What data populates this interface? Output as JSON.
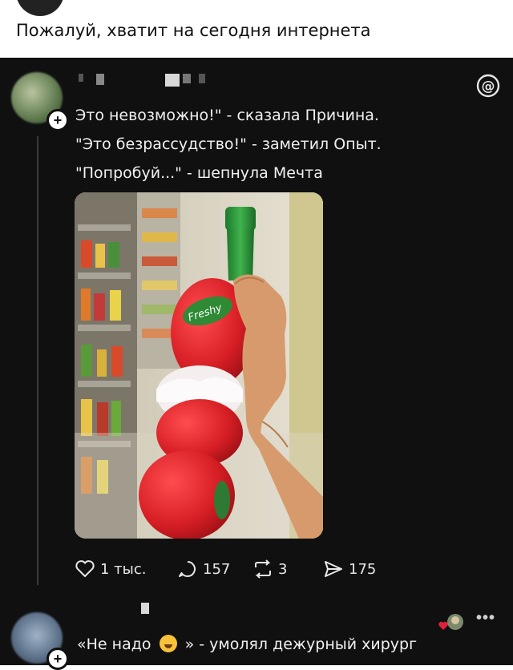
{
  "caption": "Пожалуй, хватит на сегодня интернета",
  "post": {
    "lines": [
      "Это невозможно!\" - сказала Причина.",
      "\"Это безрассудство!\" - заметил Опыт.",
      "\"Попробуй...\" - шепнула Мечта"
    ],
    "image_label": "Freshy",
    "actions": {
      "likes": "1 тыс.",
      "comments": "157",
      "reposts": "3",
      "shares": "175"
    }
  },
  "reply": {
    "text_before": "«Не надо",
    "text_after": "» - умолял дежурный хирург",
    "more": "•••"
  },
  "colors": {
    "background": "#101010",
    "text": "#f1f1f1",
    "bottle_red": "#d8252b",
    "cap_green": "#2e9a3a"
  }
}
